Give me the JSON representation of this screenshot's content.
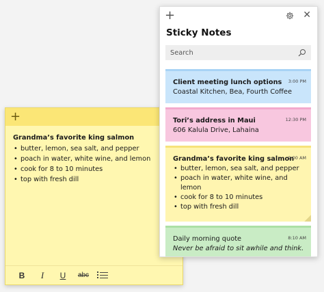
{
  "note_window": {
    "add_icon": "plus-icon",
    "more_icon": "more-icon",
    "more_label": "···",
    "title": "Grandma’s favorite king salmon",
    "items": [
      "butter, lemon, sea salt, and pepper",
      "poach in water, white wine, and lemon",
      "cook for 8 to 10 minutes",
      "top with fresh dill"
    ],
    "toolbar": {
      "bold": "B",
      "italic": "I",
      "underline": "U",
      "strikethrough": "abc",
      "bullets_icon": "bulleted-list-icon"
    },
    "colors": {
      "body": "#fff7b0",
      "titlebar": "#fbe676"
    }
  },
  "panel": {
    "add_icon": "plus-icon",
    "settings_icon": "gear-icon",
    "close_icon": "close-icon",
    "close_label": "✕",
    "title": "Sticky Notes",
    "search": {
      "placeholder": "Search",
      "icon": "search-icon"
    },
    "notes": [
      {
        "color": "blue",
        "time": "3:00 PM",
        "title": "Client meeting lunch options",
        "text": "Coastal Kitchen, Bea, Fourth Coffee"
      },
      {
        "color": "pink",
        "time": "12:30 PM",
        "title": "Tori’s address in Maui",
        "text": "606 Kalula Drive, Lahaina"
      },
      {
        "color": "yellow",
        "time": "9:00 AM",
        "title": "Grandma’s favorite king salmon",
        "items": [
          "butter, lemon, sea salt, and pepper",
          "poach in water, white wine, and lemon",
          "cook for 8 to 10 minutes",
          "top with fresh dill"
        ]
      },
      {
        "color": "green",
        "time": "8:10 AM",
        "text": "Daily morning quote",
        "quote": "Never be afraid to sit awhile and think."
      }
    ]
  }
}
